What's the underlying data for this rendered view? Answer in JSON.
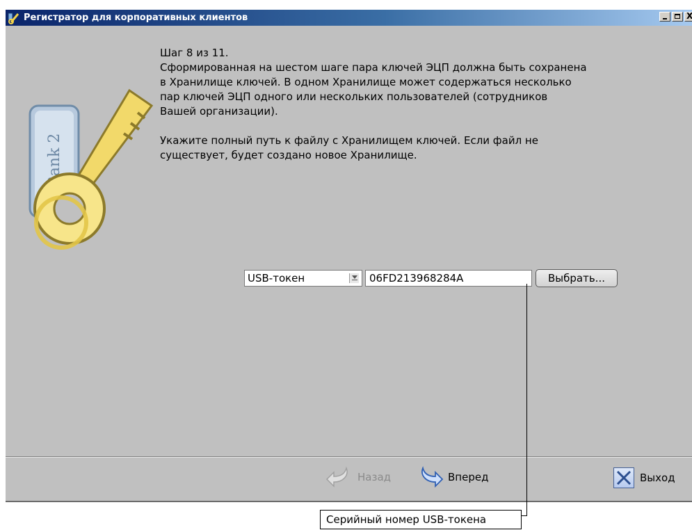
{
  "window": {
    "title": "Регистратор для корпоративных клиентов",
    "controls": {
      "minimize": "_",
      "maximize": "□",
      "close": "X"
    }
  },
  "logo": {
    "brand_text": "iBank 2",
    "icon": "key-icon"
  },
  "step": {
    "description": "Шаг 8 из 11.\nСформированная на шестом шаге пара ключей ЭЦП должна быть сохранена\nв Хранилище ключей. В одном Хранилище может содержаться несколько\nпар ключей ЭЦП одного или нескольких пользователей (сотрудников\nВашей организации).\n\nУкажите полный путь к файлу с Хранилищем ключей. Если файл не\nсуществует, будет создано новое Хранилище."
  },
  "storage": {
    "type_selected": "USB-токен",
    "serial_value": "06FD213968284A",
    "choose_label": "Выбрать..."
  },
  "nav": {
    "back_label": "Назад",
    "next_label": "Вперед",
    "exit_label": "Выход"
  },
  "annotation": {
    "label": "Серийный номер USB-токена"
  },
  "colors": {
    "window_bg": "#c0c0c0",
    "title_start": "#0a246a",
    "title_end": "#a6caf0"
  }
}
